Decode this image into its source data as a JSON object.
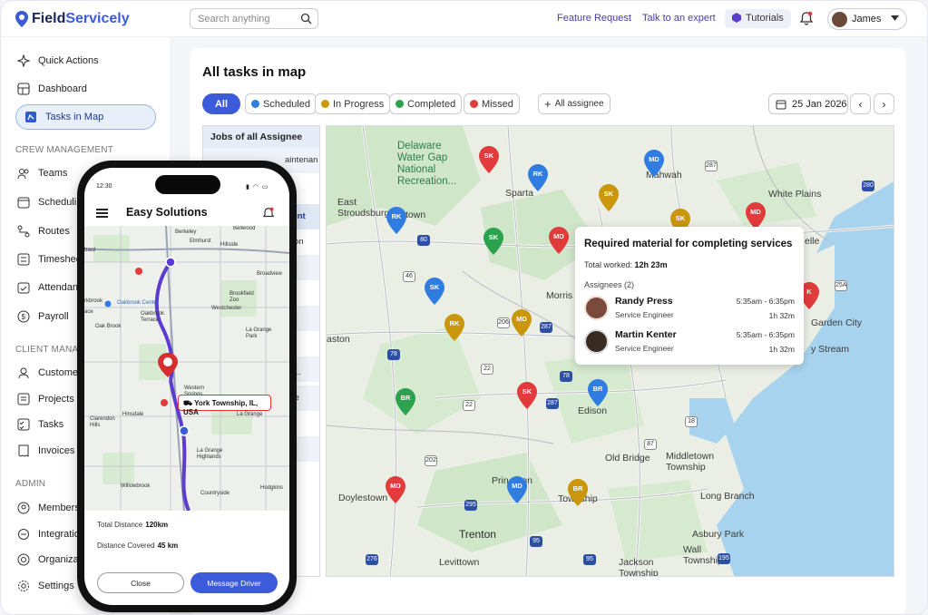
{
  "app": {
    "name_prefix": "Field",
    "name_suffix": "Servicely"
  },
  "header": {
    "search_placeholder": "Search anything",
    "feature_request": "Feature Request",
    "talk_expert": "Talk to an expert",
    "tutorials": "Tutorials",
    "user_name": "James"
  },
  "sidebar": {
    "quick_actions": "Quick Actions",
    "dashboard": "Dashboard",
    "tasks_in_map": "Tasks in Map",
    "crew_section": "CREW MANAGEMENT",
    "teams": "Teams",
    "scheduling": "Scheduling",
    "routes": "Routes",
    "timesheet": "Timesheet",
    "attendance": "Attendance",
    "payroll": "Payroll",
    "client_section": "CLIENT MANAGEMENT",
    "customers": "Customers",
    "projects": "Projects",
    "tasks": "Tasks",
    "invoices": "Invoices",
    "admin_section": "ADMIN",
    "members": "Members",
    "integrations": "Integrations",
    "organization": "Organization",
    "settings": "Settings"
  },
  "main": {
    "title": "All tasks in map",
    "filters": {
      "all": "All",
      "scheduled": "Scheduled",
      "in_progress": "In Progress",
      "completed": "Completed",
      "missed": "Missed",
      "all_assignee": "All assignee"
    },
    "date": "25 Jan 2026",
    "assignee_list": {
      "header": "Jobs of all Assignee",
      "rows": [
        "aintenan",
        "",
        "ment",
        "ation",
        "",
        "",
        "",
        "",
        "",
        "ce...",
        "ade",
        "",
        "nt"
      ]
    }
  },
  "map": {
    "labels": {
      "delaware": "Delaware\nWater Gap\nNational\nRecreation...",
      "east_stroudsburg": "East\nStroudsburg",
      "town": "town",
      "sparta": "Sparta",
      "mahwah": "Mahwah",
      "white_plains": "White Plains",
      "morris": "Morris",
      "easton": "aston",
      "edison": "Edison",
      "old_bridge": "Old Bridge",
      "middletown": "Middletown\nTownship",
      "long_branch": "Long Branch",
      "asbury_park": "Asbury Park",
      "wall": "Wall\nTownship",
      "jackson": "Jackson\nTownship",
      "trenton": "Trenton",
      "levittown": "Levittown",
      "doylestown": "Doylestown",
      "princeton": "Prin  eton",
      "manship": "Township",
      "garden_city": "Garden City",
      "valley_stream": "y Stream",
      "belle": "elle"
    },
    "pins": [
      {
        "initials": "SK",
        "color": "#e23b3b"
      },
      {
        "initials": "RK",
        "color": "#2f7de1"
      },
      {
        "initials": "MD",
        "color": "#2f7de1"
      },
      {
        "initials": "SK",
        "color": "#c9960c"
      },
      {
        "initials": "SK",
        "color": "#c9960c"
      },
      {
        "initials": "MD",
        "color": "#e23b3b"
      },
      {
        "initials": "RK",
        "color": "#2f7de1"
      },
      {
        "initials": "SK",
        "color": "#2ca24f"
      },
      {
        "initials": "MD",
        "color": "#e23b3b"
      },
      {
        "initials": "SK",
        "color": "#2f7de1"
      },
      {
        "initials": "RK",
        "color": "#c9960c"
      },
      {
        "initials": "MD",
        "color": "#c9960c"
      },
      {
        "initials": "BR",
        "color": "#2ca24f"
      },
      {
        "initials": "SK",
        "color": "#e23b3b"
      },
      {
        "initials": "BR",
        "color": "#2f7de1"
      },
      {
        "initials": "MD",
        "color": "#e23b3b"
      },
      {
        "initials": "MD",
        "color": "#2f7de1"
      },
      {
        "initials": "BR",
        "color": "#c9960c"
      },
      {
        "initials": "K",
        "color": "#e23b3b"
      }
    ],
    "shields": [
      "287",
      "80",
      "46",
      "206",
      "287",
      "78",
      "22",
      "78",
      "22",
      "287",
      "202",
      "295",
      "95",
      "276",
      "95",
      "195",
      "25A",
      "280",
      "87",
      "18"
    ]
  },
  "popup": {
    "title": "Required material for completing services",
    "total_worked_label": "Total worked:",
    "total_worked_value": "12h 23m",
    "assignees_label": "Assignees (2)",
    "people": [
      {
        "name": "Randy Press",
        "role": "Service Engineer",
        "time": "5:35am - 6:35pm",
        "duration": "1h 32m"
      },
      {
        "name": "Martin Kenter",
        "role": "Service Engineer",
        "time": "5:35am - 6:35pm",
        "duration": "1h 32m"
      }
    ]
  },
  "phone": {
    "time": "12:30",
    "title": "Easy Solutions",
    "location": "York Township, IL, USA",
    "map_labels": {
      "elmhurst": "Elmhurst",
      "brookfield": "Brookfield\nZoo",
      "oakbrook": "Oakbrook Center",
      "oakbrook_terrace": "Oakbrook\nTerrace",
      "oak_brook": "Oak Brook",
      "westchester": "Westchester",
      "broadview": "Broadview",
      "la_grange_park": "La Grange\nPark",
      "western_springs": "Western\nSprings",
      "hinsdale": "Hinsdale",
      "clarendon": "Clarendon\nHills",
      "la_grange": "La Grange",
      "la_grange_hl": "La Grange\nHighlands",
      "willowbrook": "Willowbrook",
      "countryside": "Countryside",
      "hodgkins": "Hodgkins",
      "lombard": "bard",
      "rkbrook": "rkbrook",
      "ace": "ace",
      "bellwood": "Bellwood",
      "hillside": "Hillside",
      "berkeley": "Berkeley"
    },
    "total_distance_label": "Total Distance",
    "total_distance": "120km",
    "distance_covered_label": "Distance Covered",
    "distance_covered": "45 km",
    "close": "Close",
    "message": "Message Driver"
  },
  "colors": {
    "accent": "#3b5bdb",
    "scheduled": "#2f7de1",
    "in_progress": "#c9960c",
    "completed": "#2ca24f",
    "missed": "#e23b3b"
  }
}
